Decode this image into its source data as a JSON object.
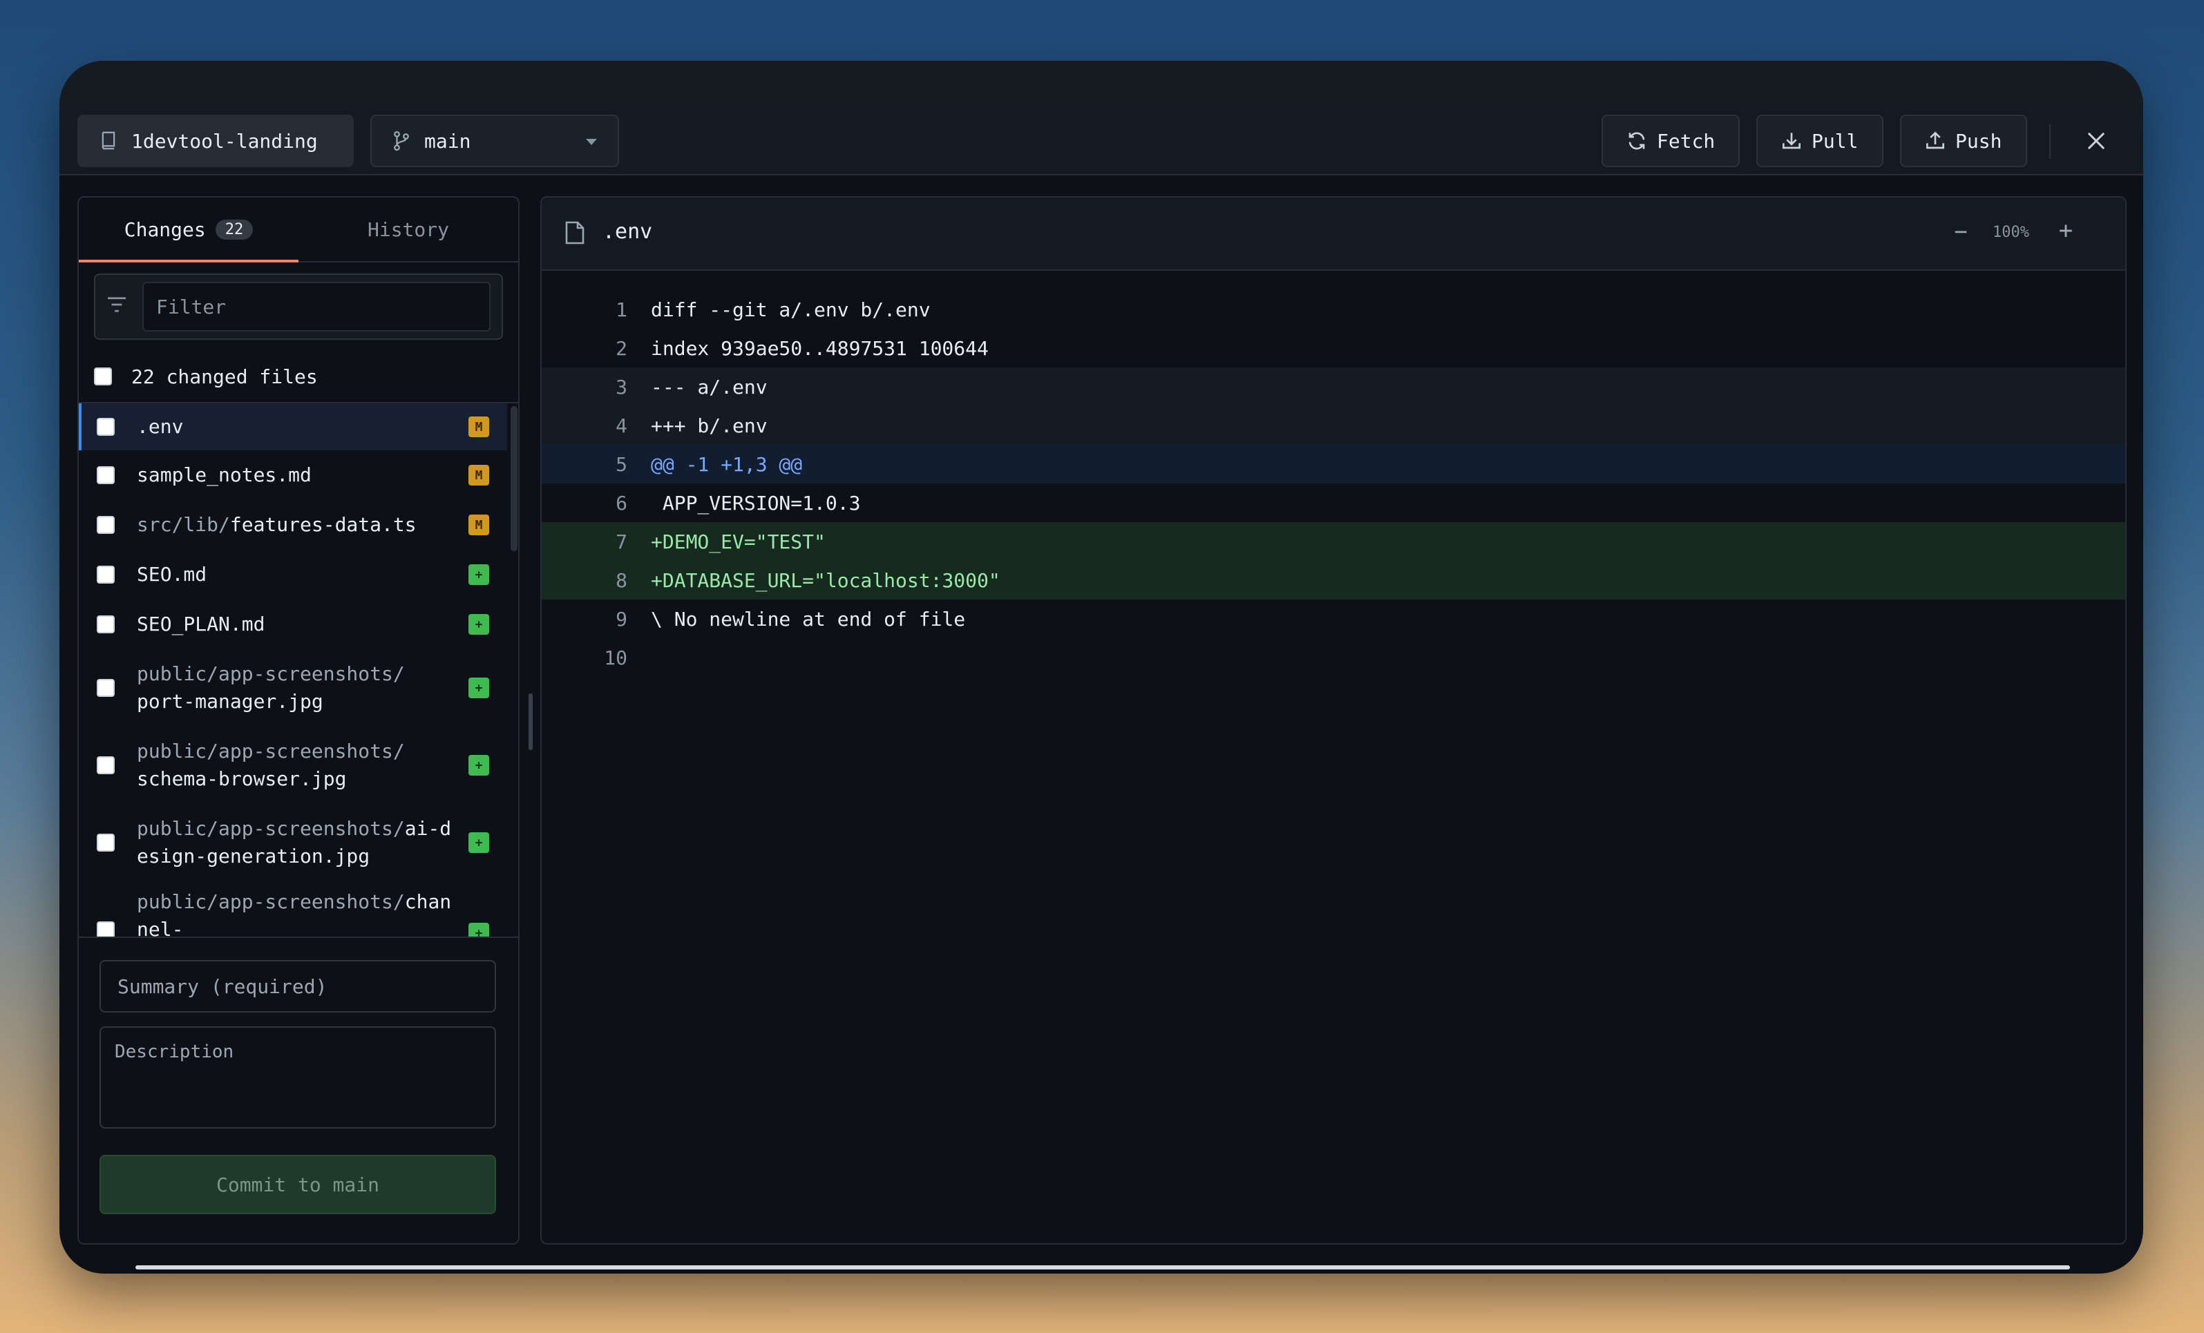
{
  "toolbar": {
    "repo_name": "1devtool-landing",
    "branch": "main",
    "fetch_label": "Fetch",
    "pull_label": "Pull",
    "push_label": "Push"
  },
  "sidebar": {
    "tabs": [
      {
        "label": "Changes",
        "count": "22",
        "active": true
      },
      {
        "label": "History",
        "active": false
      }
    ],
    "filter_placeholder": "Filter",
    "changed_files_label": "22 changed files",
    "files": [
      {
        "dir": "",
        "name": ".env",
        "status": "M"
      },
      {
        "dir": "",
        "name": "sample_notes.md",
        "status": "M"
      },
      {
        "dir": "src/lib/",
        "name": "features-data.ts",
        "status": "M"
      },
      {
        "dir": "",
        "name": "SEO.md",
        "status": "+"
      },
      {
        "dir": "",
        "name": "SEO_PLAN.md",
        "status": "+"
      },
      {
        "dir": "public/app-screenshots/",
        "name": "port-manager.jpg",
        "status": "+"
      },
      {
        "dir": "public/app-screenshots/",
        "name": "schema-browser.jpg",
        "status": "+"
      },
      {
        "dir": "public/app-screenshots/",
        "name": "ai-design-generation.jpg",
        "status": "+"
      },
      {
        "dir": "public/app-screenshots/",
        "name": "channel-",
        "status": "+"
      }
    ],
    "summary_placeholder": "Summary (required)",
    "description_placeholder": "Description",
    "commit_label": "Commit to main"
  },
  "diff": {
    "filename": ".env",
    "zoom_minus": "−",
    "zoom_level": "100%",
    "zoom_plus": "+",
    "lines": [
      {
        "n": "1",
        "text": "diff --git a/.env b/.env",
        "kind": "normal"
      },
      {
        "n": "2",
        "text": "index 939ae50..4897531 100644",
        "kind": "normal"
      },
      {
        "n": "3",
        "text": "--- a/.env",
        "kind": "meta"
      },
      {
        "n": "4",
        "text": "+++ b/.env",
        "kind": "meta"
      },
      {
        "n": "5",
        "text": "@@ -1 +1,3 @@",
        "kind": "hunk"
      },
      {
        "n": "6",
        "text": " APP_VERSION=1.0.3",
        "kind": "normal"
      },
      {
        "n": "7",
        "text": "+DEMO_EV=\"TEST\"",
        "kind": "add"
      },
      {
        "n": "8",
        "text": "+DATABASE_URL=\"localhost:3000\"",
        "kind": "add"
      },
      {
        "n": "9",
        "text": "\\ No newline at end of file",
        "kind": "normal"
      },
      {
        "n": "10",
        "text": "",
        "kind": "normal"
      }
    ]
  },
  "colors": {
    "accent_tab": "#f78166",
    "modified_badge": "#d29922",
    "added_badge": "#3fb950",
    "commit_button": "#1f3a28"
  }
}
